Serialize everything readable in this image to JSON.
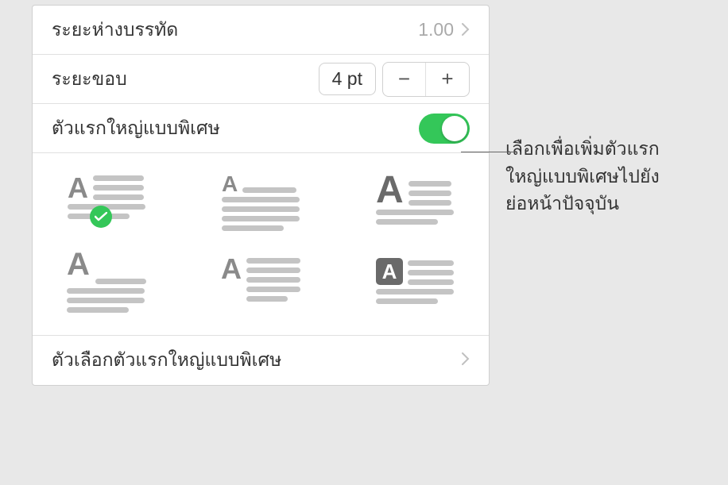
{
  "rows": {
    "line_spacing": {
      "label": "ระยะห่างบรรทัด",
      "value": "1.00"
    },
    "margin": {
      "label": "ระยะขอบ",
      "value": "4 pt"
    },
    "drop_cap": {
      "label": "ตัวแรกใหญ่แบบพิเศษ",
      "enabled": true
    },
    "drop_cap_options": {
      "label": "ตัวเลือกตัวแรกใหญ่แบบพิเศษ"
    }
  },
  "stepper": {
    "minus": "−",
    "plus": "+"
  },
  "callout": {
    "line1": "เลือกเพื่อเพิ่มตัวแรก",
    "line2": "ใหญ่แบบพิเศษไปยัง",
    "line3": "ย่อหน้าปัจจุบัน"
  },
  "drop_cap_styles": [
    {
      "id": "style-1",
      "selected": true
    },
    {
      "id": "style-2",
      "selected": false
    },
    {
      "id": "style-3",
      "selected": false
    },
    {
      "id": "style-4",
      "selected": false
    },
    {
      "id": "style-5",
      "selected": false
    },
    {
      "id": "style-6",
      "selected": false
    }
  ]
}
